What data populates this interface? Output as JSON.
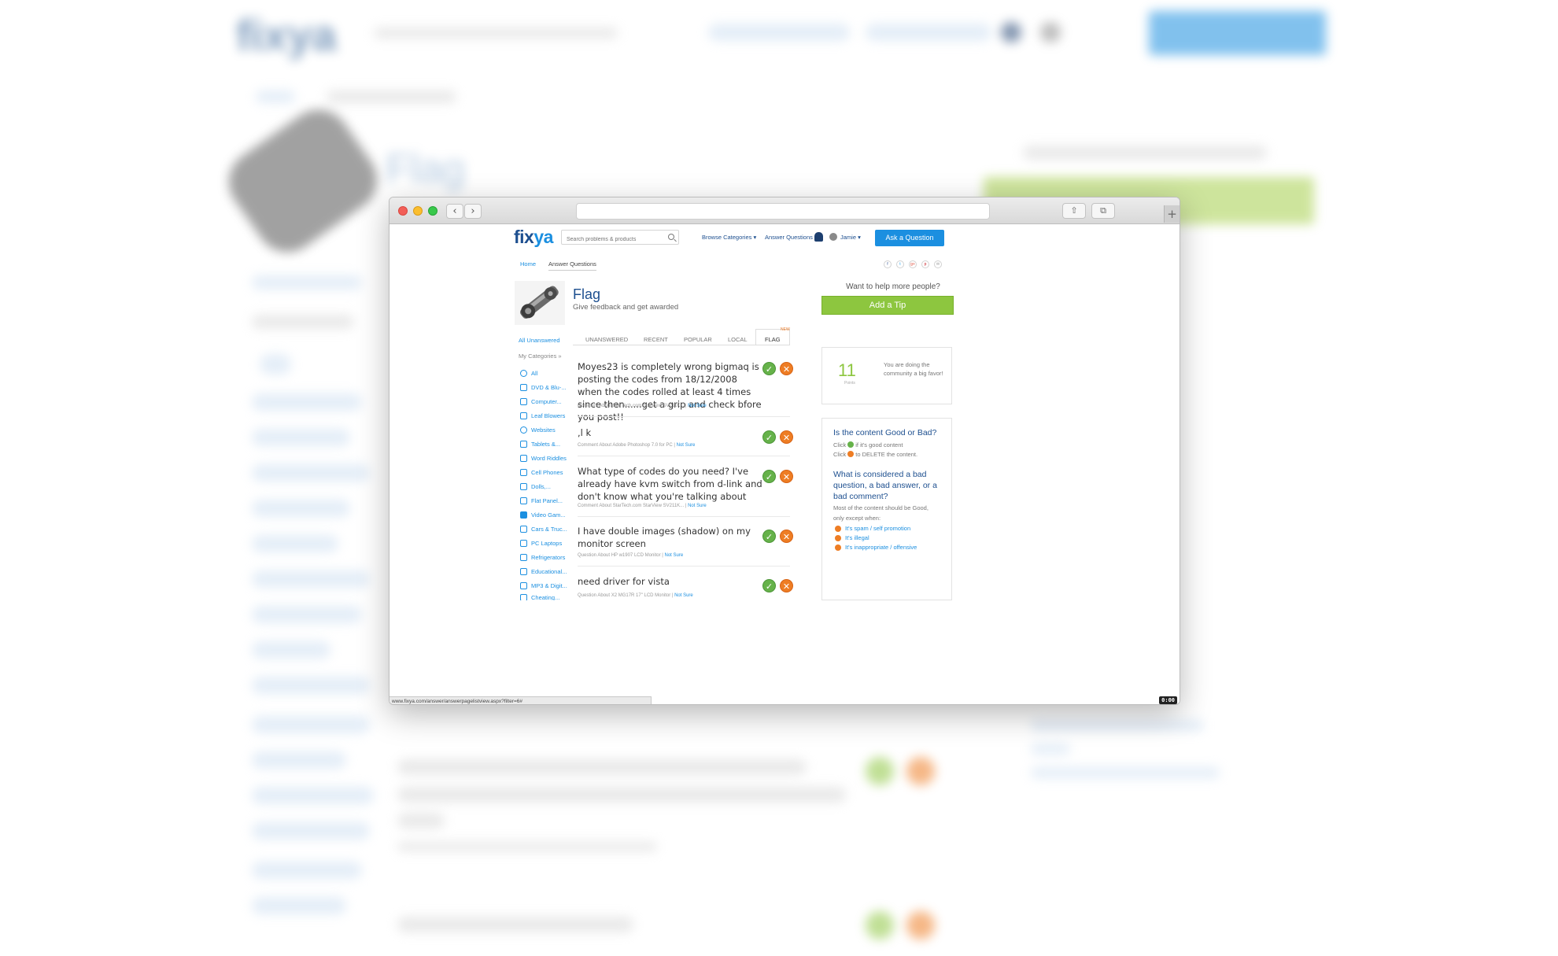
{
  "browser": {
    "status_url": "www.fixya.com/answer/answerpagelistview.aspx?filter=6#",
    "timer": "0:00"
  },
  "header": {
    "logo_main": "fix",
    "logo_accent": "ya",
    "search_placeholder": "Search problems & products",
    "browse": "Browse Categories ▾",
    "answer": "Answer Questions",
    "user": "Jamie ▾",
    "ask": "Ask a Question"
  },
  "breadcrumb": {
    "home": "Home",
    "current": "Answer Questions"
  },
  "social": [
    "f",
    "t",
    "g+",
    "p",
    "✉"
  ],
  "page": {
    "title": "Flag",
    "subtitle": "Give feedback and get awarded"
  },
  "sidebar": {
    "all_unanswered": "All Unanswered",
    "my_categories": "My Categories »",
    "items": [
      "All",
      "DVD & Blu-...",
      "Computer...",
      "Leaf Blowers",
      "Websites",
      "Tablets &...",
      "Word Riddles",
      "Cell Phones",
      "Dolls,...",
      "Flat Panel...",
      "Video Gam...",
      "Cars & Truc...",
      "PC Laptops",
      "Refrigerators",
      "Educational...",
      "MP3 & Digit...",
      "Cheating..."
    ]
  },
  "tabs": [
    "UNANSWERED",
    "RECENT",
    "POPULAR",
    "LOCAL",
    "FLAG"
  ],
  "tab_new_badge": "NEW",
  "items": [
    {
      "text": "Moyes23 is completely wrong bigmaq is posting the codes from 18/12/2008 when the codes rolled at least 4 times since then......get a grip and check bfore you post!!",
      "meta": "Comment About StarTech.com StarView SV211K... | ",
      "not_sure": "Not Sure"
    },
    {
      "text": ",l k",
      "meta": "Comment About Adobe Photoshop 7.0 for PC | ",
      "not_sure": "Not Sure"
    },
    {
      "text": "What type of codes do you need? I've already have kvm switch from d-link and don't know what you're talking about",
      "meta": "Comment About StarTech.com StarView SV211K... | ",
      "not_sure": "Not Sure"
    },
    {
      "text": "I have double images (shadow) on my monitor screen",
      "meta": "Question About HP w1907 LCD Monitor | ",
      "not_sure": "Not Sure"
    },
    {
      "text": "need driver for vista",
      "meta": "Question About X2 MG17R 17\" LCD Monitor | ",
      "not_sure": "Not Sure"
    }
  ],
  "right": {
    "want": "Want to help more people?",
    "add_tip": "Add a Tip",
    "points": "11",
    "points_label": "Points",
    "points_msg": "You are doing the community a big favor!",
    "info_title": "Is the content Good or Bad?",
    "click_good_a": "Click",
    "click_good_b": "if it's good content",
    "click_bad_a": "Click",
    "click_bad_b": "to DELETE the content.",
    "bad_title": "What is considered a bad question, a bad answer, or a bad comment?",
    "bad_line1": "Most of the content should be Good,",
    "bad_line2": "only except when:",
    "rules": [
      "It's spam / self promotion",
      "It's illegal",
      "It's inappropriate / offensive"
    ]
  }
}
